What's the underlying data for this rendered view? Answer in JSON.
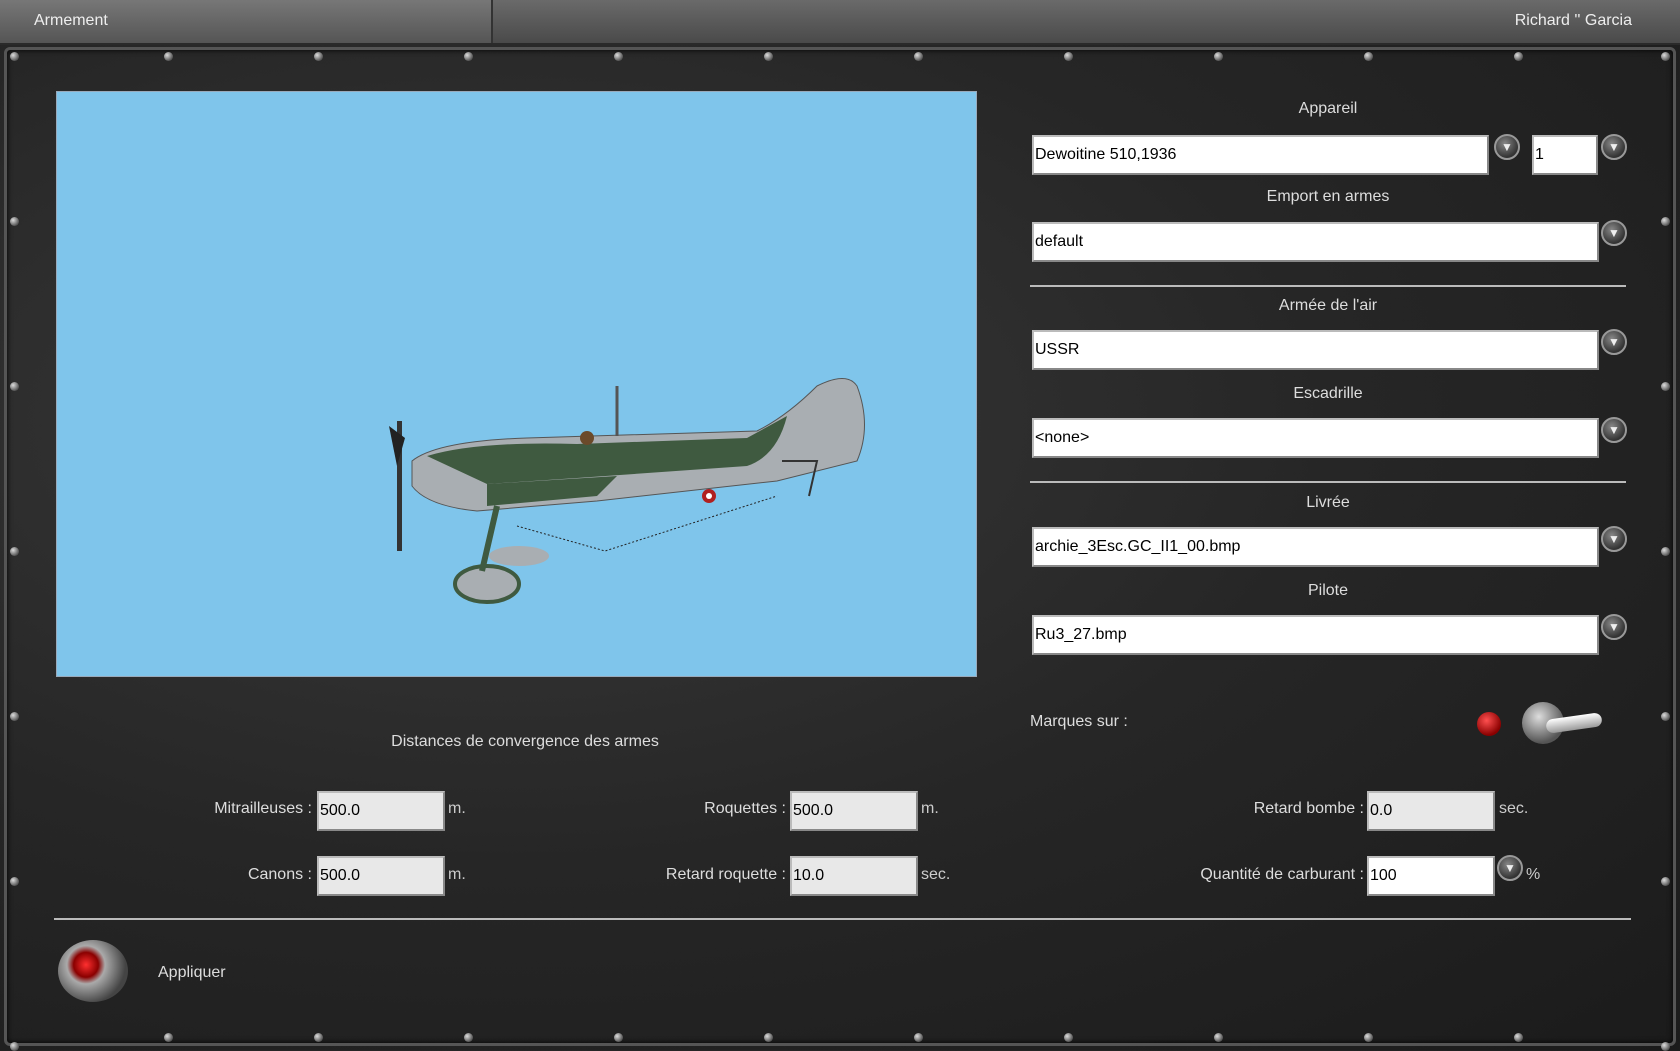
{
  "header": {
    "tab": "Armement",
    "user": "Richard '' Garcia"
  },
  "aircraft": {
    "label": "Appareil",
    "value": "Dewoitine 510,1936",
    "count": "1"
  },
  "loadout": {
    "label": "Emport en armes",
    "value": "default"
  },
  "airforce": {
    "label": "Armée de l'air",
    "value": "USSR"
  },
  "squadron": {
    "label": "Escadrille",
    "value": "<none>"
  },
  "skin": {
    "label": "Livrée",
    "value": "archie_3Esc.GC_II1_00.bmp"
  },
  "pilot": {
    "label": "Pilote",
    "value": "Ru3_27.bmp"
  },
  "markings": {
    "label": "Marques sur :",
    "indicator_color": "#c00000"
  },
  "convergence": {
    "title": "Distances de convergence des armes",
    "mg": {
      "label": "Mitrailleuses :",
      "value": "500.0",
      "unit": "m."
    },
    "cannon": {
      "label": "Canons :",
      "value": "500.0",
      "unit": "m."
    },
    "rockets": {
      "label": "Roquettes :",
      "value": "500.0",
      "unit": "m."
    },
    "rocket_delay": {
      "label": "Retard roquette :",
      "value": "10.0",
      "unit": "sec."
    },
    "bomb_delay": {
      "label": "Retard bombe :",
      "value": "0.0",
      "unit": "sec."
    },
    "fuel": {
      "label": "Quantité de carburant :",
      "value": "100",
      "unit": "%"
    }
  },
  "apply": {
    "label": "Appliquer"
  },
  "icons": {
    "dropdown": "chevron-down-icon"
  }
}
